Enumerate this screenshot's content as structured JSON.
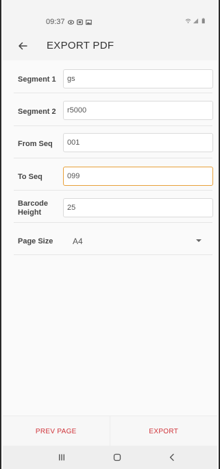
{
  "status_bar": {
    "time": "09:37"
  },
  "app_bar": {
    "title": "EXPORT PDF"
  },
  "form": {
    "segment1": {
      "label": "Segment 1",
      "value": "gs"
    },
    "segment2": {
      "label": "Segment 2",
      "value": "r5000"
    },
    "from_seq": {
      "label": "From Seq",
      "value": "001"
    },
    "to_seq": {
      "label": "To Seq",
      "value": "099"
    },
    "barcode_height": {
      "label": "Barcode Height",
      "value": "25"
    },
    "page_size": {
      "label": "Page Size",
      "value": "A4"
    }
  },
  "actions": {
    "prev_page": "PREV PAGE",
    "export": "EXPORT"
  },
  "colors": {
    "accent_focus": "#e8a13a",
    "action_text": "#d0343a"
  },
  "icons": {
    "back": "arrow-left-icon",
    "dropdown": "caret-down-icon",
    "nav_recents": "recents-icon",
    "nav_home": "home-icon",
    "nav_back": "nav-back-icon"
  }
}
